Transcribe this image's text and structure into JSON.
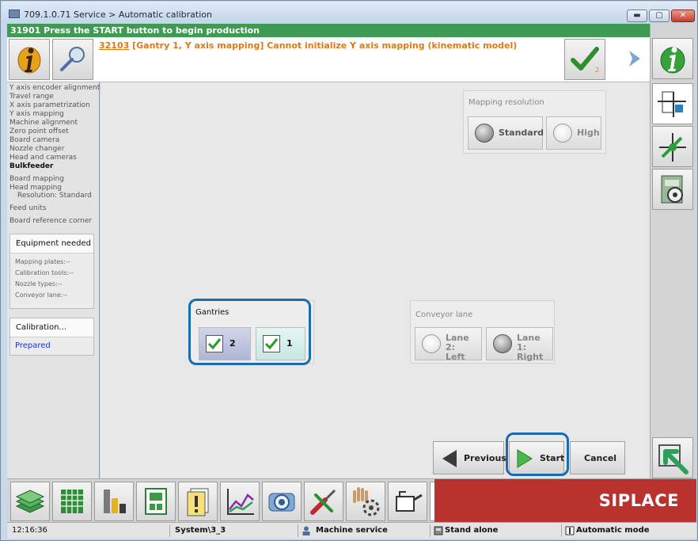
{
  "window": {
    "title": "709.1.0.71 Service > Automatic calibration",
    "min_label": "▬",
    "max_label": "▢",
    "close_label": "✕"
  },
  "instruction_bar": "31901 Press the START button to begin production",
  "message": {
    "code": "32103",
    "text": " [Gantry 1, Y axis mapping] Cannot initialize Y axis mapping (kinematic model)"
  },
  "ack_count": "2",
  "nav_items": [
    "Y axis encoder alignment",
    "Travel range",
    "X axis parametrization",
    "Y axis mapping",
    "Machine alignment",
    "Zero point offset",
    "Board camera",
    "Nozzle changer",
    "Head and cameras",
    "Bulkfeeder",
    "Board mapping",
    "Head mapping",
    "Resolution: Standard",
    "Feed units",
    "Board reference corner"
  ],
  "equipment": {
    "title": "Equipment needed",
    "lines": [
      "Mapping plates:--",
      "Calibration tools:--",
      "Nozzle types:--",
      "Conveyor lane:--"
    ]
  },
  "calibration": {
    "title": "Calibration...",
    "status": "Prepared",
    "status_color": "#1a33c8"
  },
  "mapping_resolution": {
    "title": "Mapping resolution",
    "options": [
      "Standard",
      "High"
    ],
    "selected": "Standard"
  },
  "gantries": {
    "title": "Gantries",
    "options": [
      "2",
      "1"
    ],
    "checked": [
      true,
      true
    ]
  },
  "conveyor_lane": {
    "title": "Conveyor lane",
    "options": [
      "Lane 2: Left",
      "Lane 1: Right"
    ],
    "selected": "Lane 1: Right"
  },
  "nav_buttons": {
    "previous": "Previous",
    "start": "Start",
    "cancel": "Cancel"
  },
  "brand": "SIPLACE",
  "status": {
    "time": "12:16:36",
    "system": "System\\3_3",
    "mode1": "Machine service",
    "mode2": "Stand alone",
    "mode3": "Automatic mode"
  },
  "colors": {
    "accent_green": "#3f9b54",
    "message_orange": "#e07a10",
    "highlight_blue": "#1c6ab0",
    "brand_red": "#b8322e"
  }
}
